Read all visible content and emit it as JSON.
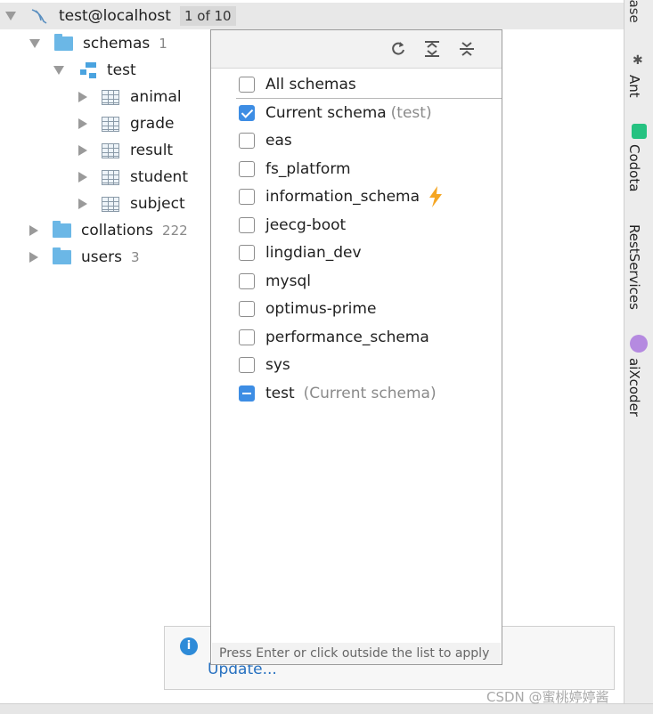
{
  "connection": {
    "title": "test@localhost",
    "pager": "1 of 10"
  },
  "tree": {
    "schemas": {
      "label": "schemas",
      "count": "1"
    },
    "test_schema": {
      "label": "test"
    },
    "tables": [
      "animal",
      "grade",
      "result",
      "student",
      "subject"
    ],
    "collations": {
      "label": "collations",
      "count": "222"
    },
    "users": {
      "label": "users",
      "count": "3"
    }
  },
  "right_tools": {
    "base": "base",
    "ant": "Ant",
    "codota": "Codota",
    "rest": "RestServices",
    "aixcoder": "aiXcoder"
  },
  "popup": {
    "items": [
      {
        "label": "All schemas",
        "suffix": "",
        "state": "unchecked"
      },
      {
        "label": "Current schema",
        "suffix": "(test)",
        "state": "checked"
      },
      {
        "label": "eas",
        "suffix": "",
        "state": "unchecked"
      },
      {
        "label": "fs_platform",
        "suffix": "",
        "state": "unchecked"
      },
      {
        "label": "information_schema",
        "suffix": "",
        "state": "unchecked"
      },
      {
        "label": "jeecg-boot",
        "suffix": "",
        "state": "unchecked"
      },
      {
        "label": "lingdian_dev",
        "suffix": "",
        "state": "unchecked"
      },
      {
        "label": "mysql",
        "suffix": "",
        "state": "unchecked"
      },
      {
        "label": "optimus-prime",
        "suffix": "",
        "state": "unchecked"
      },
      {
        "label": "performance_schema",
        "suffix": "",
        "state": "unchecked"
      },
      {
        "label": "sys",
        "suffix": "",
        "state": "unchecked"
      },
      {
        "label": "test",
        "suffix": "(Current schema)",
        "state": "partial"
      }
    ],
    "hint": "Press Enter or click outside the list to apply"
  },
  "notification": {
    "link": "Update..."
  },
  "watermark": "CSDN @蜜桃婷婷酱",
  "colors": {
    "accent": "#3d8de4",
    "folder": "#6bb7e6",
    "link": "#2670c0"
  }
}
